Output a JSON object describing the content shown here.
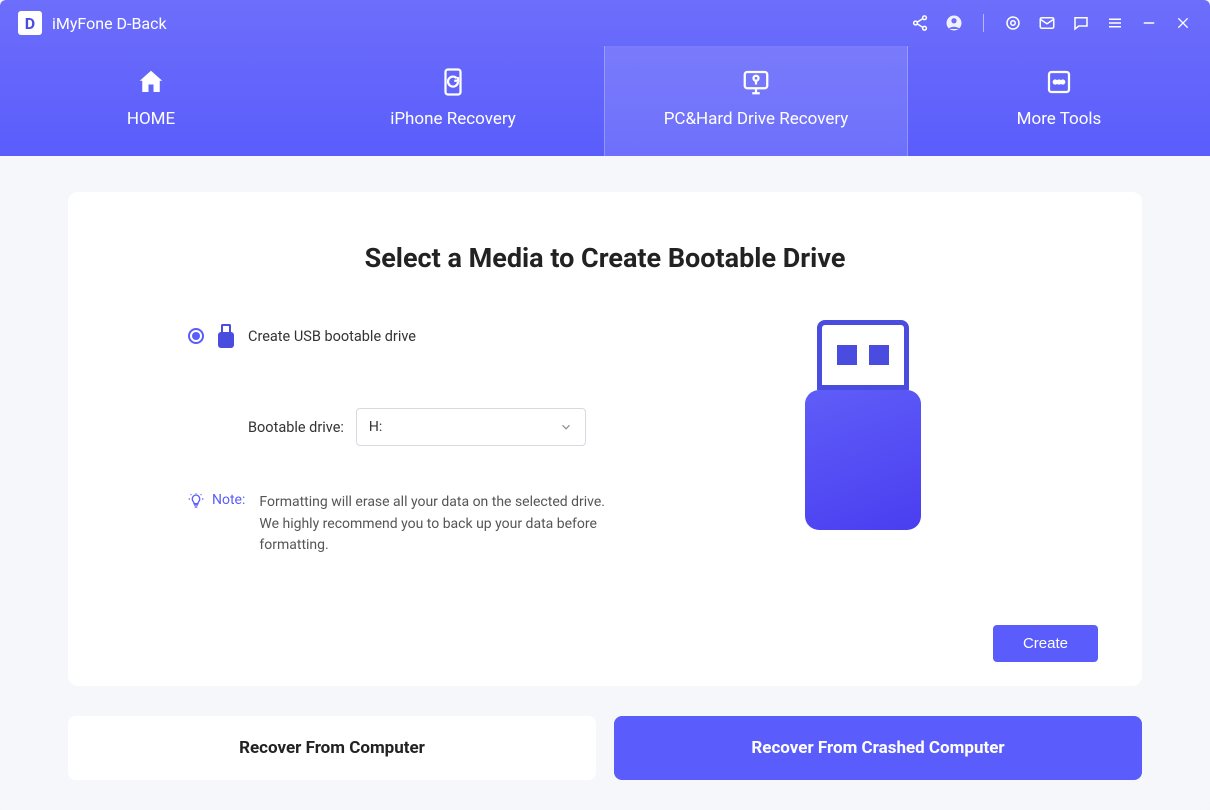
{
  "app": {
    "logo_letter": "D",
    "title": "iMyFone D-Back"
  },
  "nav": {
    "tabs": [
      {
        "label": "HOME"
      },
      {
        "label": "iPhone Recovery"
      },
      {
        "label": "PC&Hard Drive Recovery"
      },
      {
        "label": "More Tools"
      }
    ]
  },
  "card": {
    "title": "Select a Media to Create Bootable Drive",
    "radio_label": "Create USB bootable drive",
    "select_label": "Bootable drive:",
    "select_value": "H:",
    "note_label": "Note:",
    "note_text": "Formatting will erase all your data on the selected drive. We highly recommend you to back up your data before formatting.",
    "create_button": "Create"
  },
  "bottom": {
    "tab_inactive": "Recover From Computer",
    "tab_active": "Recover From Crashed Computer"
  },
  "colors": {
    "accent": "#5a5dfb"
  }
}
